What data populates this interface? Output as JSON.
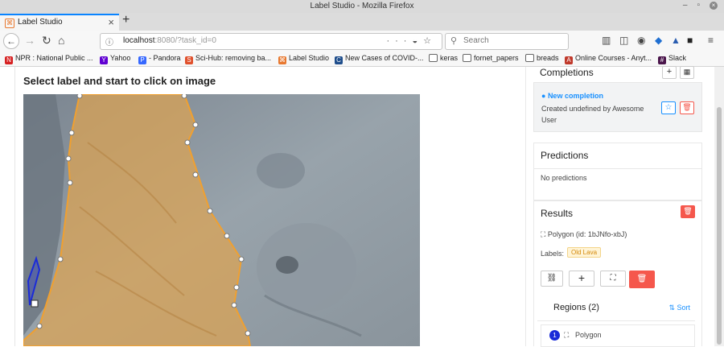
{
  "window": {
    "title": "Label Studio - Mozilla Firefox"
  },
  "tab": {
    "title": "Label Studio"
  },
  "navbar": {
    "url_host": "localhost",
    "url_path": ":8080/?task_id=0",
    "search_placeholder": "Search"
  },
  "bookmarks": [
    {
      "label": "NPR : National Public ...",
      "icon": "npr-icon",
      "color": "#d62021"
    },
    {
      "label": "Yahoo",
      "icon": "yahoo-icon",
      "color": "#6001d2"
    },
    {
      "label": "- Pandora",
      "icon": "pandora-icon",
      "color": "#3668ff"
    },
    {
      "label": "Sci-Hub: removing ba...",
      "icon": "scihub-icon",
      "color": "#e0502c"
    },
    {
      "label": "Label Studio",
      "icon": "label-studio-icon",
      "color": "#e8782f"
    },
    {
      "label": "New Cases of COVID-...",
      "icon": "cdc-icon",
      "color": "#1f4e8c"
    },
    {
      "label": "keras",
      "icon": "folder-icon",
      "color": "#666666"
    },
    {
      "label": "fornet_papers",
      "icon": "folder-icon",
      "color": "#666666"
    },
    {
      "label": "breads",
      "icon": "folder-icon",
      "color": "#666666"
    },
    {
      "label": "Online Courses - Anyt...",
      "icon": "coursera-icon",
      "color": "#c0392b"
    },
    {
      "label": "Slack",
      "icon": "slack-icon",
      "color": "#4a154b"
    }
  ],
  "main": {
    "heading": "Select label and start to click on image"
  },
  "completions": {
    "title": "Completions",
    "add_label": "+",
    "item_title": "New completion",
    "item_desc": "Created undefined by Awesome User"
  },
  "predictions": {
    "title": "Predictions",
    "empty": "No predictions"
  },
  "results": {
    "title": "Results",
    "region_title": "Polygon (id: 1bJNfo-xbJ)",
    "labels_caption": "Labels:",
    "label_tag": "Old Lava",
    "add_label": "+"
  },
  "regions": {
    "title": "Regions (2)",
    "sort_label": "Sort",
    "items": [
      {
        "index": "1",
        "label": "Polygon"
      }
    ]
  },
  "colors": {
    "accent": "#1890ff",
    "danger": "#f5574c",
    "polygon": "#f0a030",
    "tag_bg": "#fff4d6",
    "tag_text": "#d4890b"
  }
}
